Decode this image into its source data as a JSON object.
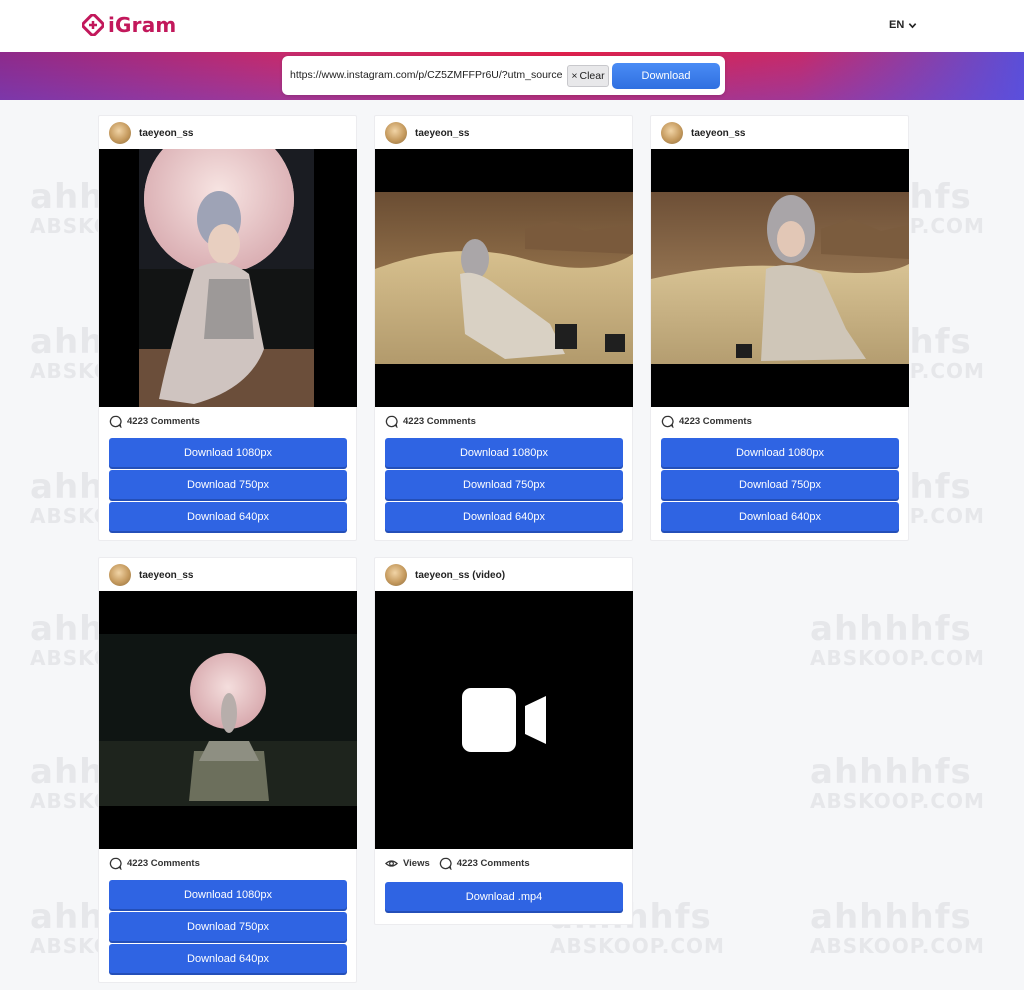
{
  "header": {
    "logo_text": "iGram",
    "language": "EN"
  },
  "search": {
    "url_value": "https://www.instagram.com/p/CZ5ZMFFPr6U/?utm_source",
    "clear_label": "Clear",
    "download_label": "Download"
  },
  "watermark": {
    "line1": "ahhhhfs",
    "line2": "ABSKOOP.COM"
  },
  "cards": [
    {
      "username": "taeyeon_ss",
      "comments": "4223 Comments",
      "buttons": [
        "Download 1080px",
        "Download 750px",
        "Download 640px"
      ]
    },
    {
      "username": "taeyeon_ss",
      "comments": "4223 Comments",
      "buttons": [
        "Download 1080px",
        "Download 750px",
        "Download 640px"
      ]
    },
    {
      "username": "taeyeon_ss",
      "comments": "4223 Comments",
      "buttons": [
        "Download 1080px",
        "Download 750px",
        "Download 640px"
      ]
    },
    {
      "username": "taeyeon_ss",
      "comments": "4223 Comments",
      "buttons": [
        "Download 1080px",
        "Download 750px",
        "Download 640px"
      ]
    },
    {
      "username": "taeyeon_ss (video)",
      "views": "Views",
      "comments": "4223 Comments",
      "buttons": [
        "Download .mp4"
      ]
    }
  ],
  "colors": {
    "brand": "#c2185b",
    "button": "#2f64e3",
    "gradient": [
      "#8e2a8a",
      "#e0204a",
      "#5a4fd8"
    ]
  },
  "icons": {
    "logo": "igram-logo-icon",
    "comment": "comment-bubble-icon",
    "views": "eye-icon",
    "video": "video-camera-icon",
    "chevron": "chevron-down-icon"
  }
}
